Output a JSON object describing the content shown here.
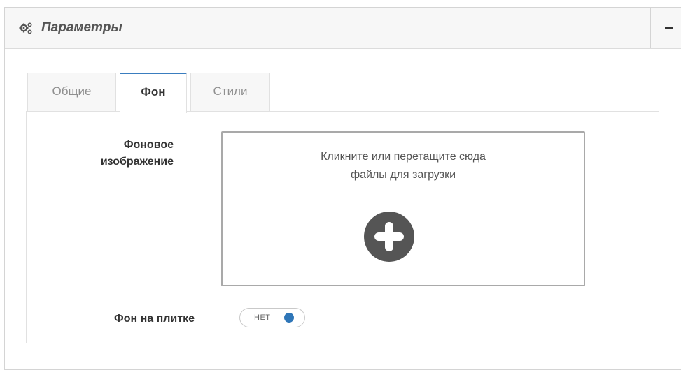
{
  "panel": {
    "title": "Параметры",
    "icon": "gears-icon",
    "collapse_icon": "minus-icon"
  },
  "tabs": [
    {
      "label": "Общие",
      "active": false
    },
    {
      "label": "Фон",
      "active": true
    },
    {
      "label": "Стили",
      "active": false
    }
  ],
  "background_tab": {
    "image_label": "Фоновое\nизображение",
    "dropzone_text": "Кликните или перетащите сюда\nфайлы для загрузки",
    "dropzone_icon": "plus-circle-icon",
    "tile_label": "Фон на плитке",
    "tile_toggle": {
      "label": "НЕТ",
      "on": false
    }
  },
  "colors": {
    "accent": "#3a7dbf",
    "toggle_knob": "#2f76b8",
    "plus_circle": "#555555"
  }
}
